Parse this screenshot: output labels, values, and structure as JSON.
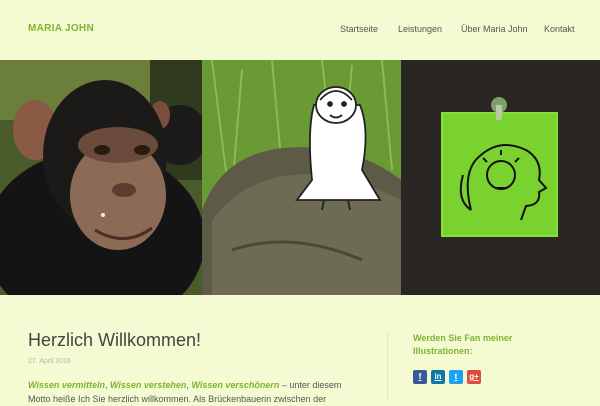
{
  "header": {
    "logo": "MARIA JOHN",
    "nav": [
      "Startseite",
      "Leistungen",
      "Über Maria John",
      "Kontakt"
    ]
  },
  "hero": {
    "panels": [
      "chimpanzee-photo",
      "girl-on-rock-illustration",
      "sticky-note-head-illustration"
    ]
  },
  "post": {
    "title": "Herzlich Willkommen!",
    "date": "27. April 2016",
    "highlight1": "Wissen vermitteln",
    "sep1": ", ",
    "highlight2": "Wissen verstehen",
    "sep2": ", ",
    "highlight3": "Wissen verschönern",
    "body_rest": " – unter diesem Motto heiße Ich Sie herzlich willkommen. Als Brückenbauerin zwischen der"
  },
  "sidebar": {
    "heading": "Werden Sie Fan meiner Illustrationen:",
    "social": [
      {
        "name": "facebook",
        "glyph": "f",
        "color": "#3b5998"
      },
      {
        "name": "linkedin",
        "glyph": "in",
        "color": "#0e76a8"
      },
      {
        "name": "twitter",
        "glyph": "t",
        "color": "#1da1f2"
      },
      {
        "name": "google-plus",
        "glyph": "g+",
        "color": "#dd4b39"
      }
    ]
  },
  "colors": {
    "background": "#f4fbd3",
    "accent": "#7fb42f",
    "text": "#444444"
  }
}
